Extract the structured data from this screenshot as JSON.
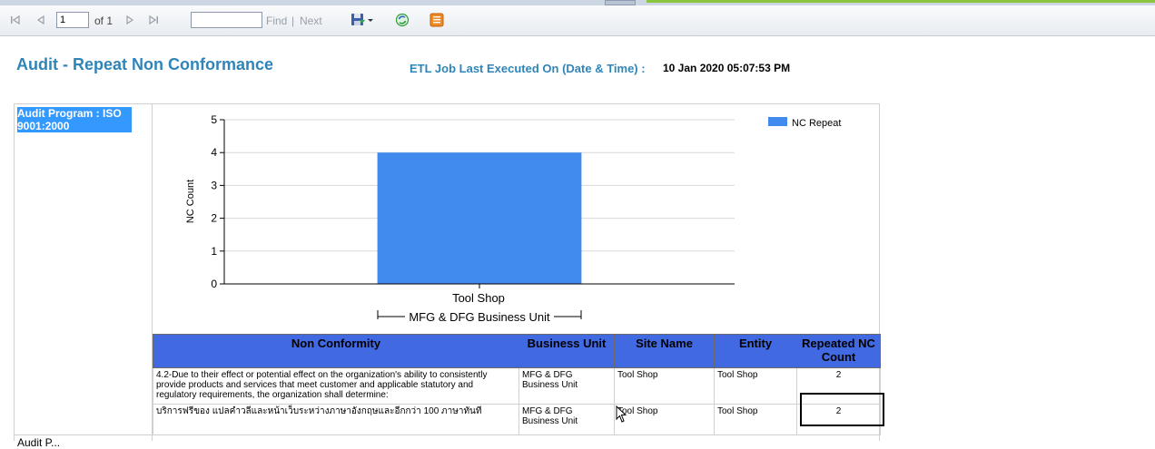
{
  "toolbar": {
    "page_value": "1",
    "page_of": "of 1",
    "find_placeholder": "",
    "find_label": "Find",
    "separator": "|",
    "next_label": "Next"
  },
  "header": {
    "title": "Audit - Repeat Non Conformance",
    "etl_label": "ETL Job Last Executed On (Date & Time) :",
    "etl_value": "10 Jan 2020 05:07:53 PM"
  },
  "sections": [
    {
      "program_label": "Audit Program : ISO 9001:2000"
    },
    {
      "program_label": "Audit P..."
    }
  ],
  "chart_data": {
    "type": "bar",
    "categories": [
      "Tool Shop"
    ],
    "group_label": "MFG & DFG Business Unit",
    "series": [
      {
        "name": "NC Repeat",
        "values": [
          4
        ],
        "color": "#428bee"
      }
    ],
    "ylabel": "NC Count",
    "xlabel": "",
    "ylim": [
      0,
      5
    ],
    "yticks": [
      "0",
      "1",
      "2",
      "3",
      "4",
      "5"
    ],
    "grid": true,
    "legend": "top-right"
  },
  "table": {
    "headers": [
      "Non Conformity",
      "Business Unit",
      "Site Name",
      "Entity",
      "Repeated NC Count"
    ],
    "rows": [
      {
        "non_conformity": "4.2-Due to their effect or potential effect on the organization's ability to consistently provide products and services that meet customer and applicable statutory and regulatory requirements, the organization shall determine:",
        "business_unit": "MFG & DFG Business Unit",
        "site_name": "Tool Shop",
        "entity": "Tool Shop",
        "count": "2"
      },
      {
        "non_conformity": "บริการฟรีของ แปลคำวลีและหน้าเว็บระหว่างภาษาอังกฤษและอีกกว่า 100 ภาษาทันที",
        "business_unit": "MFG & DFG Business Unit",
        "site_name": "Tool Shop",
        "entity": "Tool Shop",
        "count": "2"
      }
    ]
  },
  "colors": {
    "accent": "#2f85b8",
    "table_header": "#4169e1",
    "bar": "#428bee",
    "selection": "#3399ff"
  },
  "icons": [
    "first-page-icon",
    "previous-page-icon",
    "next-page-icon",
    "last-page-icon",
    "export-save-icon",
    "refresh-icon",
    "document-map-icon",
    "mouse-cursor-icon"
  ]
}
